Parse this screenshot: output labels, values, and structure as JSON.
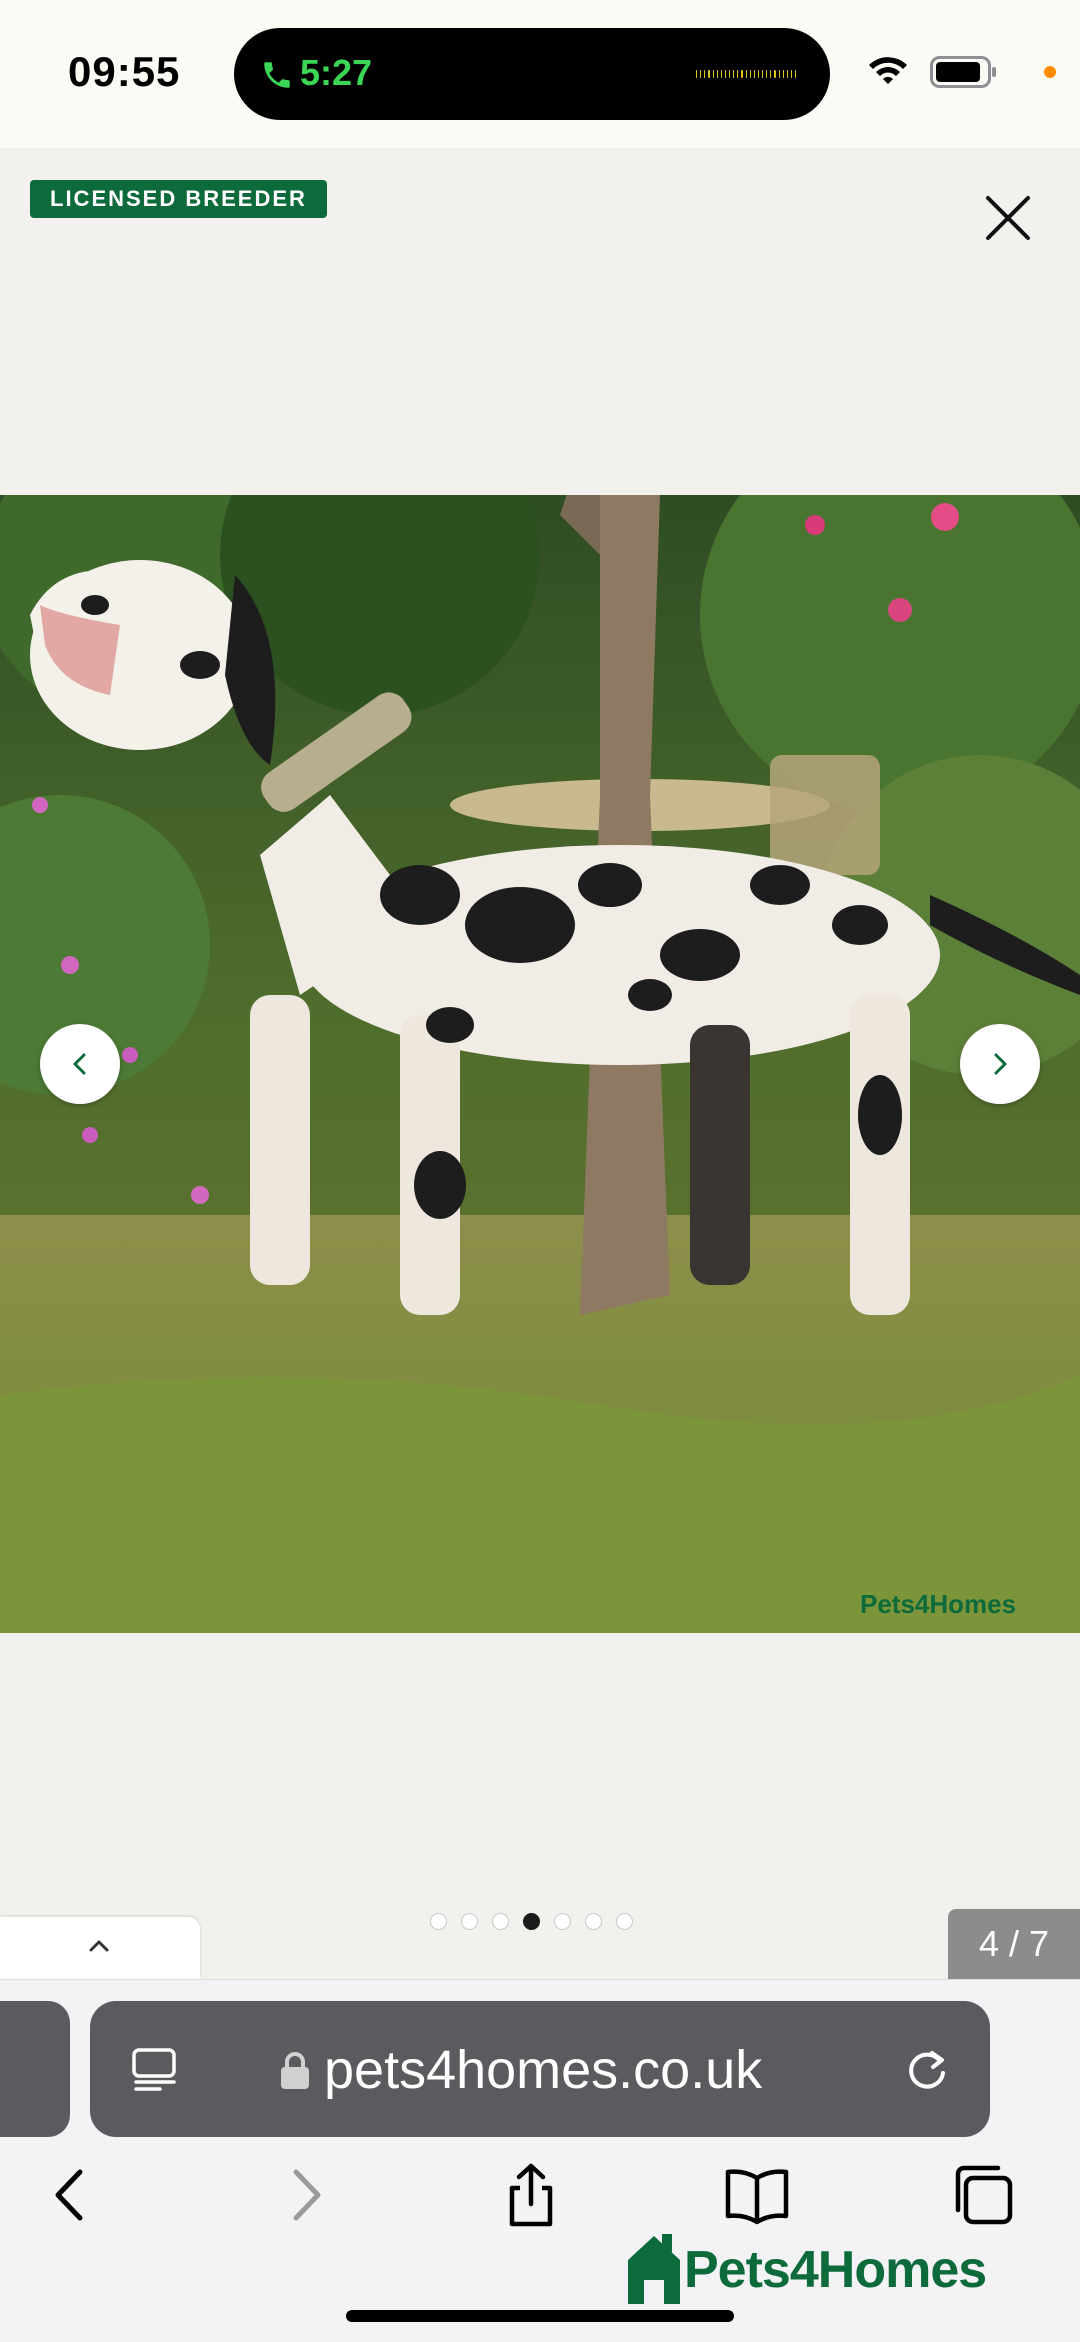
{
  "status_bar": {
    "time": "09:55",
    "call_duration": "5:27"
  },
  "listing": {
    "badge": "LICENSED BREEDER"
  },
  "gallery": {
    "counter": "4 / 7",
    "total": 7,
    "current": 4,
    "watermark": "Pets4Homes"
  },
  "browser": {
    "url": "pets4homes.co.uk"
  },
  "footer": {
    "logo_text": "Pets4Homes"
  },
  "colors": {
    "brand_green": "#0d6b3b",
    "call_green": "#3bd656"
  }
}
